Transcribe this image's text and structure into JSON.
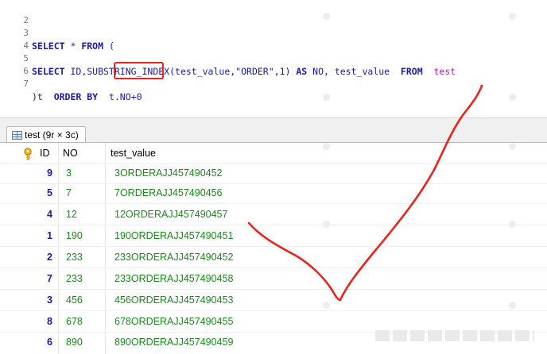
{
  "editor": {
    "line_numbers": [
      "2",
      "3",
      "4",
      "5",
      "6",
      "7"
    ],
    "line3": {
      "kw1": "SELECT",
      "rest": " * ",
      "kw2": "FROM",
      "paren": " ("
    },
    "line5": {
      "kw1": "SELECT",
      "cols": " ID,SUBSTRING_INDEX(test_value,",
      "str": "\"ORDER\"",
      "num": ",1) ",
      "kw_as": "AS",
      "alias": " NO, test_value  ",
      "kw_from": "FROM",
      "table": "test"
    },
    "line7": {
      "close": ")t  ",
      "kw_order": "ORDER BY",
      "expr": "t.NO+0"
    }
  },
  "result_tab": {
    "label": "test (9r × 3c)"
  },
  "grid": {
    "columns": [
      "ID",
      "NO",
      "test_value"
    ],
    "rows": [
      {
        "id": "9",
        "no": "3",
        "test_value": "3ORDERAJJ457490452"
      },
      {
        "id": "5",
        "no": "7",
        "test_value": "7ORDERAJJ457490456"
      },
      {
        "id": "4",
        "no": "12",
        "test_value": "12ORDERAJJ457490457"
      },
      {
        "id": "1",
        "no": "190",
        "test_value": "190ORDERAJJ457490451"
      },
      {
        "id": "2",
        "no": "233",
        "test_value": "233ORDERAJJ457490452"
      },
      {
        "id": "7",
        "no": "233",
        "test_value": "233ORDERAJJ457490458"
      },
      {
        "id": "3",
        "no": "456",
        "test_value": "456ORDERAJJ457490453"
      },
      {
        "id": "8",
        "no": "678",
        "test_value": "678ORDERAJJ457490455"
      },
      {
        "id": "6",
        "no": "890",
        "test_value": "890ORDERAJJ457490459"
      }
    ]
  },
  "colors": {
    "keyword": "#1a1aa6",
    "table_name": "#c418c4",
    "value_green": "#1a8a1a",
    "annotation_red": "#e8241c"
  }
}
